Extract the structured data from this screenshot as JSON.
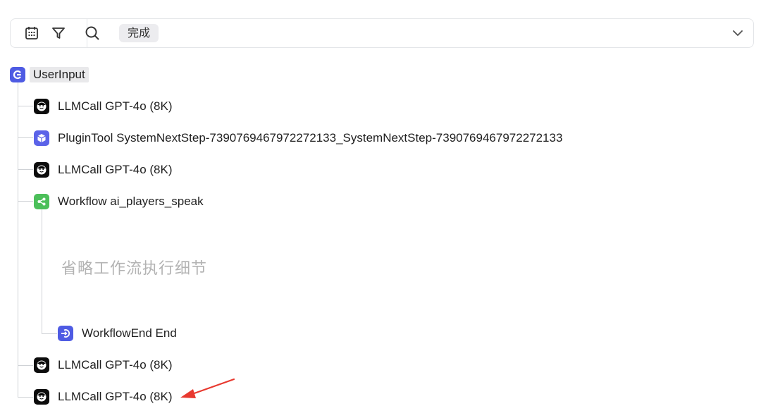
{
  "toolbar": {
    "status_tag": "完成",
    "icons": [
      "calendar-icon",
      "filter-icon",
      "search-icon",
      "chevron-down-icon"
    ]
  },
  "tree": {
    "root": {
      "label": "UserInput",
      "icon": "user-input-icon",
      "color": "#4e5be3"
    },
    "children": [
      {
        "label": "LLMCall GPT-4o (8K)",
        "icon": "llm-face-icon"
      },
      {
        "label": "PluginTool SystemNextStep-7390769467972272133_SystemNextStep-7390769467972272133",
        "icon": "plugin-cube-icon",
        "color": "#5b63e8"
      },
      {
        "label": "LLMCall GPT-4o (8K)",
        "icon": "llm-face-icon"
      },
      {
        "label": "Workflow ai_players_speak",
        "icon": "workflow-icon",
        "color": "#4cbf5a"
      },
      {
        "label": "LLMCall GPT-4o (8K)",
        "icon": "llm-face-icon"
      },
      {
        "label": "LLMCall GPT-4o (8K)",
        "icon": "llm-face-icon"
      }
    ],
    "workflow_children": [
      {
        "label": "WorkflowEnd End",
        "icon": "workflow-end-icon",
        "color": "#4e5be3"
      }
    ],
    "omitted_note": "省略工作流执行细节"
  },
  "annotation": {
    "arrow_color": "#e8392f"
  }
}
